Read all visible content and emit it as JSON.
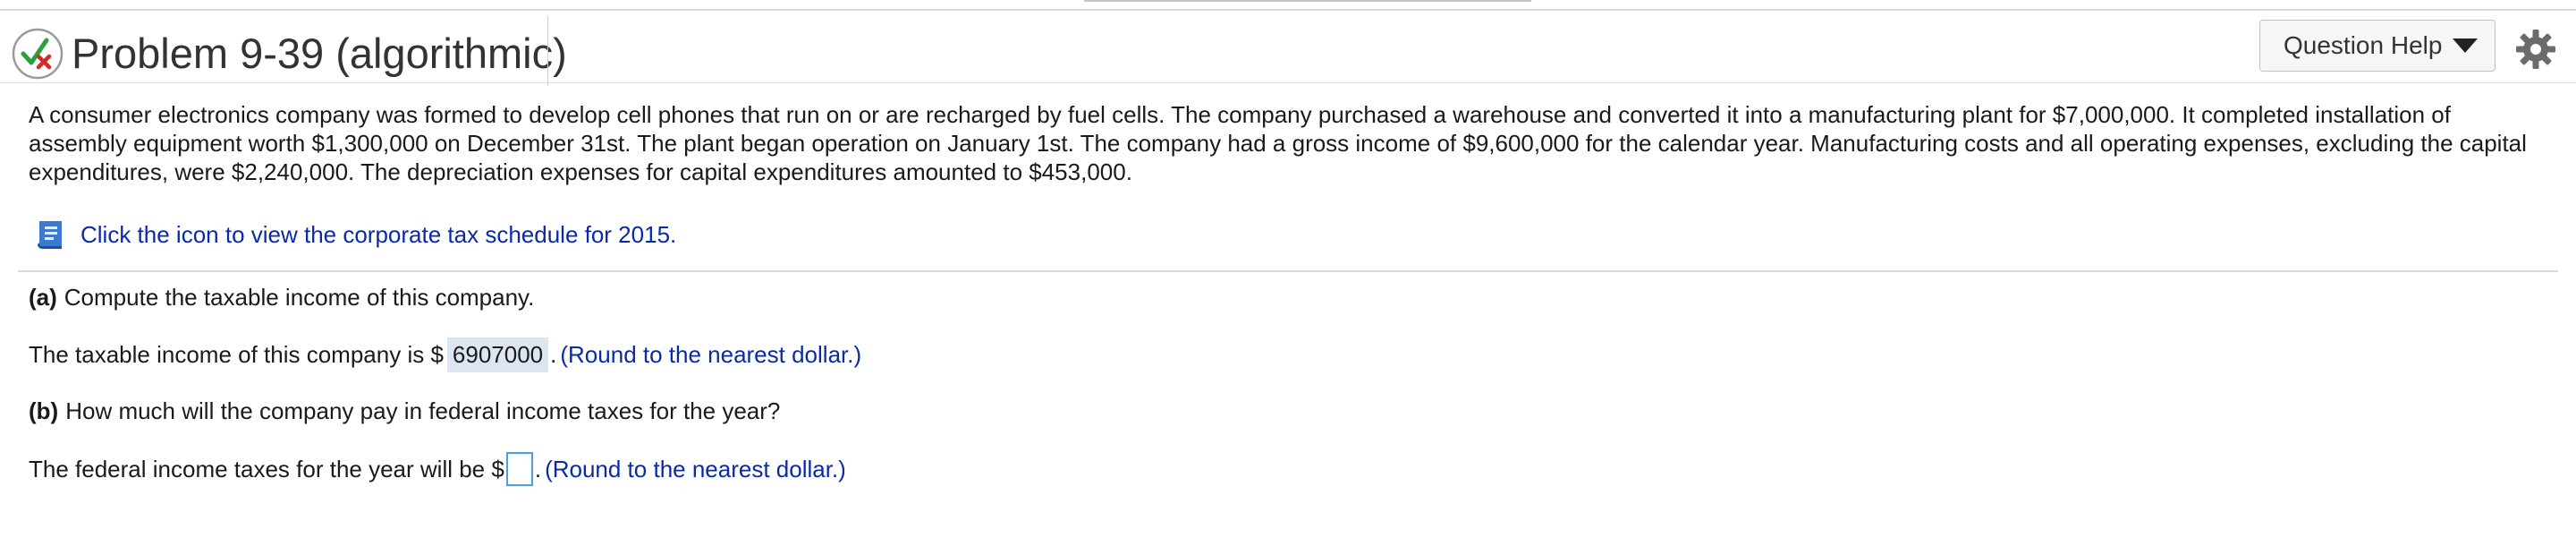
{
  "header": {
    "title": "Problem 9-39 (algorithmic)",
    "help_label": "Question Help",
    "status_icon": "check-x-icon",
    "settings_icon": "gear-icon"
  },
  "problem_text": "A consumer electronics company was formed to develop cell phones that run on or are recharged by fuel cells. The company purchased a warehouse and converted it into a manufacturing plant for $7,000,000. It completed installation of assembly equipment worth $1,300,000 on December 31st. The plant began operation on January 1st. The company had a gross income of $9,600,000 for the calendar year. Manufacturing costs and all operating expenses, excluding the capital expenditures, were $2,240,000. The depreciation expenses for capital expenditures amounted to $453,000.",
  "tax_link": {
    "icon": "book-icon",
    "label": "Click the icon to view the corporate tax schedule for 2015."
  },
  "part_a": {
    "tag": "(a)",
    "question": "Compute the taxable income of this company.",
    "answer_prefix": "The taxable income of this company is $",
    "answer_value": "6907000",
    "answer_suffix": ".",
    "hint": "(Round to the nearest dollar.)"
  },
  "part_b": {
    "tag": "(b)",
    "question": "How much will the company pay in federal income taxes for the year?",
    "answer_prefix": "The federal income taxes for the year will be $",
    "answer_value": "",
    "answer_suffix": ".",
    "hint": "(Round to the nearest dollar.)"
  },
  "colors": {
    "link": "#0a2aa6",
    "answer_highlight": "#dde5f0",
    "input_border": "#4aa0d8",
    "check_green": "#2e9e3e",
    "x_red": "#d42a2a"
  }
}
